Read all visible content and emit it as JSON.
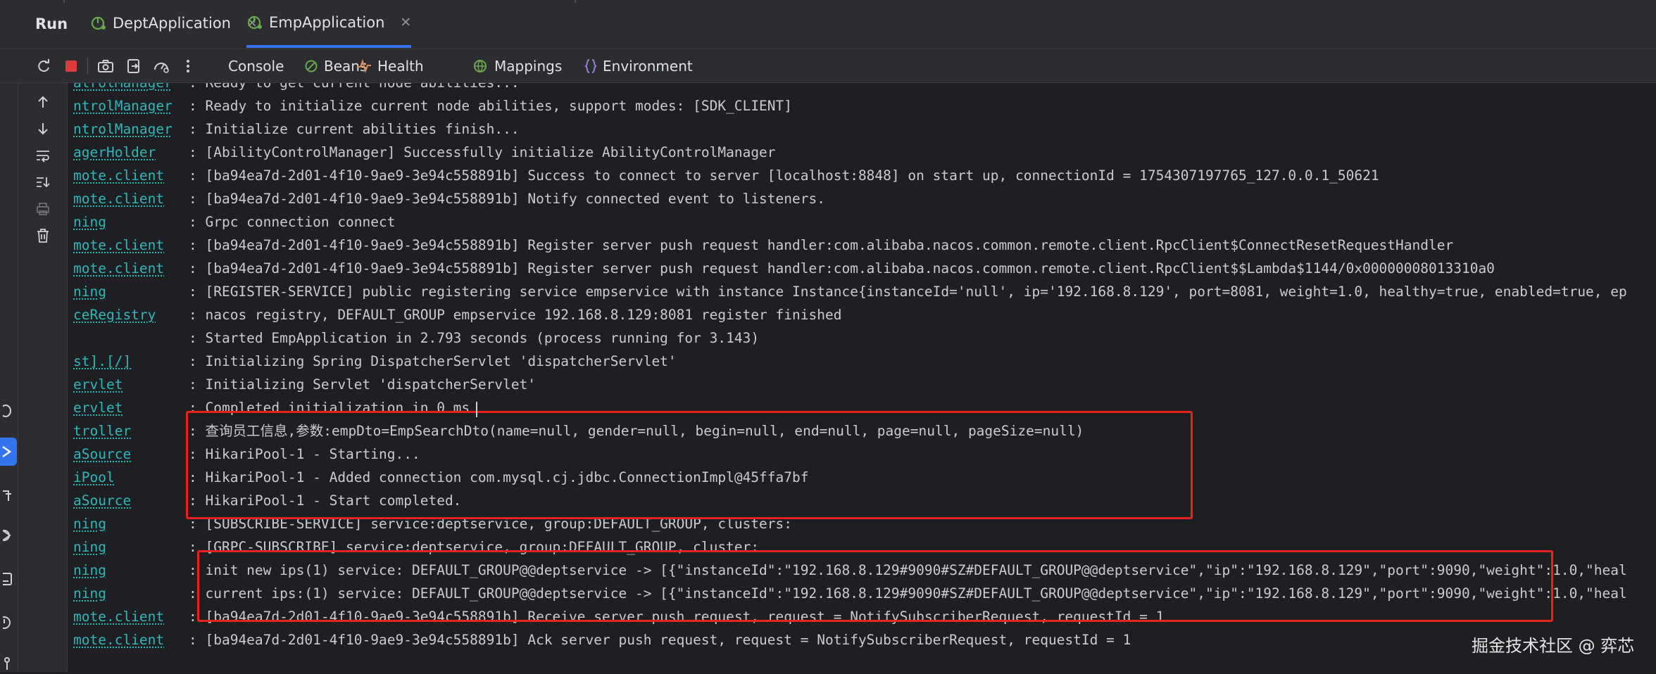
{
  "window": {
    "run_title": "Run",
    "tabs": [
      {
        "label": "DeptApplication",
        "active": false
      },
      {
        "label": "EmpApplication",
        "active": true
      }
    ]
  },
  "toolbar": {
    "views": [
      {
        "label": "Console",
        "icon": "console-icon"
      },
      {
        "label": "Beans",
        "icon": "beans-icon"
      },
      {
        "label": "Health",
        "icon": "health-icon"
      },
      {
        "label": "Mappings",
        "icon": "mappings-icon"
      },
      {
        "label": "Environment",
        "icon": "environment-icon"
      }
    ]
  },
  "console": {
    "lines": [
      {
        "logger": "atrolManager",
        "message": ": Ready to get current node abilities..."
      },
      {
        "logger": "ntrolManager",
        "message": ": Ready to initialize current node abilities, support modes: [SDK_CLIENT]"
      },
      {
        "logger": "ntrolManager",
        "message": ": Initialize current abilities finish..."
      },
      {
        "logger": "agerHolder",
        "message": ": [AbilityControlManager] Successfully initialize AbilityControlManager"
      },
      {
        "logger": "mote.client",
        "message": ": [ba94ea7d-2d01-4f10-9ae9-3e94c558891b] Success to connect to server [localhost:8848] on start up, connectionId = 1754307197765_127.0.0.1_50621"
      },
      {
        "logger": "mote.client",
        "message": ": [ba94ea7d-2d01-4f10-9ae9-3e94c558891b] Notify connected event to listeners."
      },
      {
        "logger": "ning",
        "message": ": Grpc connection connect"
      },
      {
        "logger": "mote.client",
        "message": ": [ba94ea7d-2d01-4f10-9ae9-3e94c558891b] Register server push request handler:com.alibaba.nacos.common.remote.client.RpcClient$ConnectResetRequestHandler"
      },
      {
        "logger": "mote.client",
        "message": ": [ba94ea7d-2d01-4f10-9ae9-3e94c558891b] Register server push request handler:com.alibaba.nacos.common.remote.client.RpcClient$$Lambda$1144/0x00000008013310a0"
      },
      {
        "logger": "ning",
        "message": ": [REGISTER-SERVICE] public registering service empservice with instance Instance{instanceId='null', ip='192.168.8.129', port=8081, weight=1.0, healthy=true, enabled=true, ep"
      },
      {
        "logger": "ceRegistry",
        "message": ": nacos registry, DEFAULT_GROUP empservice 192.168.8.129:8081 register finished"
      },
      {
        "logger": "",
        "message": ": Started EmpApplication in 2.793 seconds (process running for 3.143)"
      },
      {
        "logger": "st].[/]",
        "message": ": Initializing Spring DispatcherServlet 'dispatcherServlet'"
      },
      {
        "logger": "ervlet",
        "message": ": Initializing Servlet 'dispatcherServlet'"
      },
      {
        "logger": "ervlet",
        "message": ": Completed initialization in 0 ms"
      },
      {
        "logger": "troller",
        "message": ": 查询员工信息,参数:empDto=EmpSearchDto(name=null, gender=null, begin=null, end=null, page=null, pageSize=null)"
      },
      {
        "logger": "aSource",
        "message": ": HikariPool-1 - Starting..."
      },
      {
        "logger": "iPool",
        "message": ": HikariPool-1 - Added connection com.mysql.cj.jdbc.ConnectionImpl@45ffa7bf"
      },
      {
        "logger": "aSource",
        "message": ": HikariPool-1 - Start completed."
      },
      {
        "logger": "ning",
        "message": ": [SUBSCRIBE-SERVICE] service:deptservice, group:DEFAULT_GROUP, clusters:"
      },
      {
        "logger": "ning",
        "message": ": [GRPC-SUBSCRIBE] service:deptservice, group:DEFAULT_GROUP, cluster:"
      },
      {
        "logger": "ning",
        "message": ": init new ips(1) service: DEFAULT_GROUP@@deptservice -> [{\"instanceId\":\"192.168.8.129#9090#SZ#DEFAULT_GROUP@@deptservice\",\"ip\":\"192.168.8.129\",\"port\":9090,\"weight\":1.0,\"heal"
      },
      {
        "logger": "ning",
        "message": ": current ips:(1) service: DEFAULT_GROUP@@deptservice -> [{\"instanceId\":\"192.168.8.129#9090#SZ#DEFAULT_GROUP@@deptservice\",\"ip\":\"192.168.8.129\",\"port\":9090,\"weight\":1.0,\"heal"
      },
      {
        "logger": "mote.client",
        "message": ": [ba94ea7d-2d01-4f10-9ae9-3e94c558891b] Receive server push request, request = NotifySubscriberRequest, requestId = 1"
      },
      {
        "logger": "mote.client",
        "message": ": [ba94ea7d-2d01-4f10-9ae9-3e94c558891b] Ack server push request, request = NotifySubscriberRequest, requestId = 1"
      }
    ]
  },
  "watermark": "掘金技术社区 @ 弈芯",
  "colors": {
    "background": "#1e1f22",
    "panel": "#2b2d30",
    "logger_teal": "#2fb6b9",
    "highlight_red": "#e8231f",
    "active_tab_underline": "#3574f0"
  }
}
